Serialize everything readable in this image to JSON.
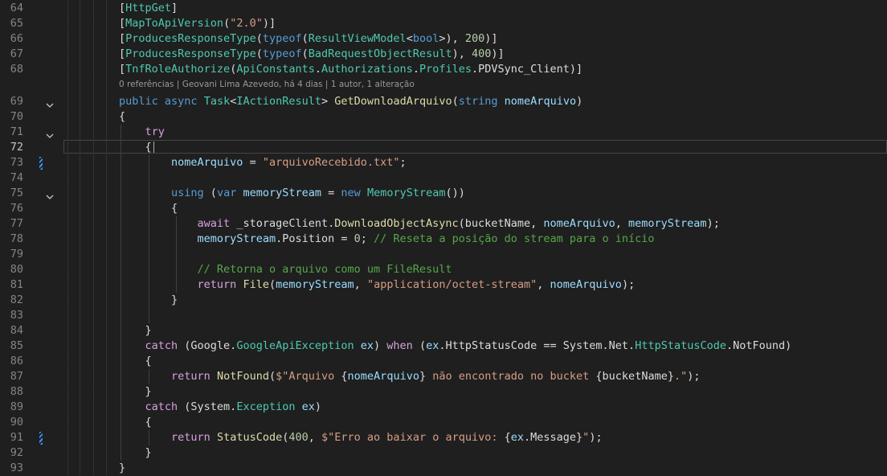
{
  "editor": {
    "active_line": "72",
    "caret_after_line": "72",
    "codelens": "0 referências | Geovani Lima Azevedo, há 4 dias | 1 autor, 1 alteração",
    "folded_lines": [
      "69",
      "71",
      "75"
    ],
    "changed_lines": [
      "73",
      "91"
    ],
    "colors": {
      "background": "#1f1f1f",
      "keyword": "#569cd6",
      "control": "#d8a0df",
      "type": "#4ec9b0",
      "method": "#dcdcaa",
      "variable": "#9cdcfe",
      "string": "#d69d85",
      "number": "#b5cea8",
      "comment": "#57a64a",
      "change_marker": "#3794ff"
    },
    "lines": [
      {
        "n": "64",
        "tokens": [
          [
            "pl",
            "["
          ],
          [
            "type",
            "HttpGet"
          ],
          [
            "pl",
            "]"
          ]
        ]
      },
      {
        "n": "65",
        "tokens": [
          [
            "pl",
            "["
          ],
          [
            "type",
            "MapToApiVersion"
          ],
          [
            "pl",
            "("
          ],
          [
            "str",
            "\"2.0\""
          ],
          [
            "pl",
            ")]"
          ]
        ]
      },
      {
        "n": "66",
        "tokens": [
          [
            "pl",
            "["
          ],
          [
            "type",
            "ProducesResponseType"
          ],
          [
            "pl",
            "("
          ],
          [
            "kw",
            "typeof"
          ],
          [
            "pl",
            "("
          ],
          [
            "type",
            "ResultViewModel"
          ],
          [
            "pl",
            "<"
          ],
          [
            "kw",
            "bool"
          ],
          [
            "pl",
            ">), "
          ],
          [
            "num",
            "200"
          ],
          [
            "pl",
            ")]"
          ]
        ]
      },
      {
        "n": "67",
        "tokens": [
          [
            "pl",
            "["
          ],
          [
            "type",
            "ProducesResponseType"
          ],
          [
            "pl",
            "("
          ],
          [
            "kw",
            "typeof"
          ],
          [
            "pl",
            "("
          ],
          [
            "type",
            "BadRequestObjectResult"
          ],
          [
            "pl",
            "), "
          ],
          [
            "num",
            "400"
          ],
          [
            "pl",
            ")]"
          ]
        ]
      },
      {
        "n": "68",
        "tokens": [
          [
            "pl",
            "["
          ],
          [
            "type",
            "TnfRoleAuthorize"
          ],
          [
            "pl",
            "("
          ],
          [
            "type",
            "ApiConstants"
          ],
          [
            "pl",
            "."
          ],
          [
            "type",
            "Authorizations"
          ],
          [
            "pl",
            "."
          ],
          [
            "type",
            "Profiles"
          ],
          [
            "pl",
            ".PDVSync_Client)]"
          ]
        ]
      },
      {
        "n": "69",
        "tokens": [
          [
            "kw",
            "public"
          ],
          [
            "pl",
            " "
          ],
          [
            "kw",
            "async"
          ],
          [
            "pl",
            " "
          ],
          [
            "type",
            "Task"
          ],
          [
            "pl",
            "<"
          ],
          [
            "type",
            "IActionResult"
          ],
          [
            "pl",
            "> "
          ],
          [
            "fn",
            "GetDownloadArquivo"
          ],
          [
            "pl",
            "("
          ],
          [
            "kw",
            "string"
          ],
          [
            "pl",
            " "
          ],
          [
            "var",
            "nomeArquivo"
          ],
          [
            "pl",
            ")"
          ]
        ]
      },
      {
        "n": "70",
        "tokens": [
          [
            "pl",
            "{"
          ]
        ]
      },
      {
        "n": "71",
        "tokens": [
          [
            "pl",
            "    "
          ],
          [
            "ctl",
            "try"
          ]
        ]
      },
      {
        "n": "72",
        "tokens": [
          [
            "pl",
            "    {"
          ]
        ]
      },
      {
        "n": "73",
        "tokens": [
          [
            "pl",
            "        "
          ],
          [
            "var",
            "nomeArquivo"
          ],
          [
            "pl",
            " = "
          ],
          [
            "str",
            "\"arquivoRecebido.txt\""
          ],
          [
            "pl",
            ";"
          ]
        ]
      },
      {
        "n": "74",
        "tokens": []
      },
      {
        "n": "75",
        "tokens": [
          [
            "pl",
            "        "
          ],
          [
            "kw",
            "using"
          ],
          [
            "pl",
            " ("
          ],
          [
            "kw",
            "var"
          ],
          [
            "pl",
            " "
          ],
          [
            "var",
            "memoryStream"
          ],
          [
            "pl",
            " = "
          ],
          [
            "kw",
            "new"
          ],
          [
            "pl",
            " "
          ],
          [
            "type",
            "MemoryStream"
          ],
          [
            "pl",
            "())"
          ]
        ]
      },
      {
        "n": "76",
        "tokens": [
          [
            "pl",
            "        {"
          ]
        ]
      },
      {
        "n": "77",
        "tokens": [
          [
            "pl",
            "            "
          ],
          [
            "ctl",
            "await"
          ],
          [
            "pl",
            " _storageClient."
          ],
          [
            "fn",
            "DownloadObjectAsync"
          ],
          [
            "pl",
            "(bucketName, "
          ],
          [
            "var",
            "nomeArquivo"
          ],
          [
            "pl",
            ", "
          ],
          [
            "var",
            "memoryStream"
          ],
          [
            "pl",
            ");"
          ]
        ]
      },
      {
        "n": "78",
        "tokens": [
          [
            "pl",
            "            "
          ],
          [
            "var",
            "memoryStream"
          ],
          [
            "pl",
            ".Position = "
          ],
          [
            "num",
            "0"
          ],
          [
            "pl",
            "; "
          ],
          [
            "com",
            "// Reseta a posição do stream para o início"
          ]
        ]
      },
      {
        "n": "79",
        "tokens": []
      },
      {
        "n": "80",
        "tokens": [
          [
            "pl",
            "            "
          ],
          [
            "com",
            "// Retorna o arquivo como um FileResult"
          ]
        ]
      },
      {
        "n": "81",
        "tokens": [
          [
            "pl",
            "            "
          ],
          [
            "ctl",
            "return"
          ],
          [
            "pl",
            " "
          ],
          [
            "fn",
            "File"
          ],
          [
            "pl",
            "("
          ],
          [
            "var",
            "memoryStream"
          ],
          [
            "pl",
            ", "
          ],
          [
            "str",
            "\"application/octet-stream\""
          ],
          [
            "pl",
            ", "
          ],
          [
            "var",
            "nomeArquivo"
          ],
          [
            "pl",
            ");"
          ]
        ]
      },
      {
        "n": "82",
        "tokens": [
          [
            "pl",
            "        }"
          ]
        ]
      },
      {
        "n": "83",
        "tokens": []
      },
      {
        "n": "84",
        "tokens": [
          [
            "pl",
            "    }"
          ]
        ]
      },
      {
        "n": "85",
        "tokens": [
          [
            "pl",
            "    "
          ],
          [
            "ctl",
            "catch"
          ],
          [
            "pl",
            " (Google."
          ],
          [
            "type",
            "GoogleApiException"
          ],
          [
            "pl",
            " "
          ],
          [
            "var",
            "ex"
          ],
          [
            "pl",
            ") "
          ],
          [
            "ctl",
            "when"
          ],
          [
            "pl",
            " ("
          ],
          [
            "var",
            "ex"
          ],
          [
            "pl",
            ".HttpStatusCode == System.Net."
          ],
          [
            "type",
            "HttpStatusCode"
          ],
          [
            "pl",
            ".NotFound)"
          ]
        ]
      },
      {
        "n": "86",
        "tokens": [
          [
            "pl",
            "    {"
          ]
        ]
      },
      {
        "n": "87",
        "tokens": [
          [
            "pl",
            "        "
          ],
          [
            "ctl",
            "return"
          ],
          [
            "pl",
            " "
          ],
          [
            "fn",
            "NotFound"
          ],
          [
            "pl",
            "("
          ],
          [
            "str",
            "$\"Arquivo "
          ],
          [
            "pl",
            "{"
          ],
          [
            "var",
            "nomeArquivo"
          ],
          [
            "pl",
            "}"
          ],
          [
            "str",
            " não encontrado no bucket "
          ],
          [
            "pl",
            "{bucketName}"
          ],
          [
            "str",
            ".\""
          ],
          [
            "pl",
            ");"
          ]
        ]
      },
      {
        "n": "88",
        "tokens": [
          [
            "pl",
            "    }"
          ]
        ]
      },
      {
        "n": "89",
        "tokens": [
          [
            "pl",
            "    "
          ],
          [
            "ctl",
            "catch"
          ],
          [
            "pl",
            " (System."
          ],
          [
            "type",
            "Exception"
          ],
          [
            "pl",
            " "
          ],
          [
            "var",
            "ex"
          ],
          [
            "pl",
            ")"
          ]
        ]
      },
      {
        "n": "90",
        "tokens": [
          [
            "pl",
            "    {"
          ]
        ]
      },
      {
        "n": "91",
        "tokens": [
          [
            "pl",
            "        "
          ],
          [
            "ctl",
            "return"
          ],
          [
            "pl",
            " "
          ],
          [
            "fn",
            "StatusCode"
          ],
          [
            "pl",
            "("
          ],
          [
            "num",
            "400"
          ],
          [
            "pl",
            ", "
          ],
          [
            "str",
            "$\"Erro ao baixar o arquivo: "
          ],
          [
            "pl",
            "{"
          ],
          [
            "var",
            "ex"
          ],
          [
            "pl",
            ".Message}"
          ],
          [
            "str",
            "\""
          ],
          [
            "pl",
            ");"
          ]
        ]
      },
      {
        "n": "92",
        "tokens": [
          [
            "pl",
            "    }"
          ]
        ]
      },
      {
        "n": "93",
        "tokens": [
          [
            "pl",
            "}"
          ]
        ]
      }
    ]
  }
}
